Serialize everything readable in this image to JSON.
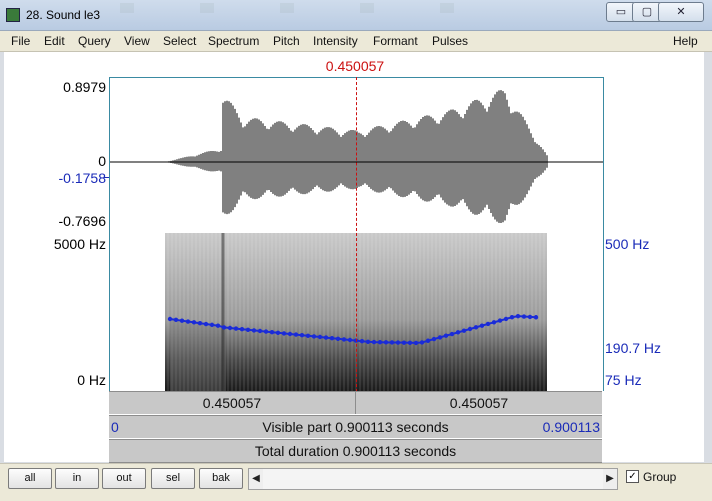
{
  "window": {
    "title": "28. Sound le3",
    "min_glyph": "▭",
    "max_glyph": "▢",
    "close_glyph": "✕"
  },
  "menu": [
    "File",
    "Edit",
    "Query",
    "View",
    "Select",
    "Spectrum",
    "Pitch",
    "Intensity",
    "Formant",
    "Pulses"
  ],
  "help_label": "Help",
  "cursor_time": "0.450057",
  "waveform": {
    "y_max": "0.8979",
    "y_zero": "0",
    "y_value": "-0.1758",
    "y_min": "-0.7696"
  },
  "spectrogram": {
    "freq_top": "5000 Hz",
    "freq_bottom": "0 Hz",
    "pitch_top": "500 Hz",
    "pitch_value": "190.7 Hz",
    "pitch_bottom": "75 Hz"
  },
  "time_row": {
    "left": "0.450057",
    "right": "0.450057"
  },
  "visible_row": {
    "start": "0",
    "label": "Visible part 0.900113 seconds",
    "end": "0.900113"
  },
  "total_row": {
    "label": "Total duration 0.900113 seconds"
  },
  "buttons": {
    "all": "all",
    "in": "in",
    "out": "out",
    "sel": "sel",
    "bak": "bak"
  },
  "scroll": {
    "left_arrow": "◀",
    "right_arrow": "▶"
  },
  "group": {
    "label": "Group",
    "checked_glyph": "✓"
  },
  "colors": {
    "cursor": "#cc1111",
    "pitch": "#1a2bd8",
    "frame": "#3a8aa2"
  },
  "icons": {
    "app": "sound-app-icon"
  }
}
